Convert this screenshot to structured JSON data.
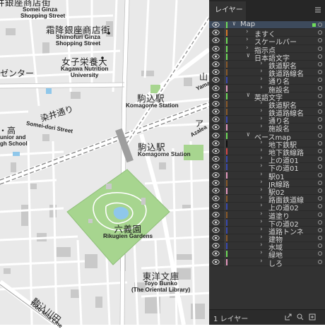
{
  "map": {
    "labels": [
      {
        "key": "somei",
        "jp": "井銀座商店街",
        "en1": "Somei Ginza",
        "en2": "Shopping Street"
      },
      {
        "key": "shimofuri",
        "jp": "霜降銀座商店街",
        "en1": "Shimofuri Ginza",
        "en2": "Shopping Street"
      },
      {
        "key": "kagawa",
        "jp": "女子栄養大",
        "en1": "Kagawa Nutrition",
        "en2": "University"
      },
      {
        "key": "komagome_st1",
        "jp": "駒込駅",
        "en1": "Komagome Station",
        "en2": ""
      },
      {
        "key": "komagome_st2",
        "jp": "駒込駅",
        "en1": "Komagome Station",
        "en2": ""
      },
      {
        "key": "rikugien",
        "jp": "六義園",
        "en1": "Rikugien Gardens",
        "en2": ""
      },
      {
        "key": "toyo",
        "jp": "東洋文庫",
        "en1": "Toyo Bunko",
        "en2": "(The Oriental Library)"
      }
    ],
    "roads": {
      "someidori_jp": "染井通り",
      "someidori_en": "Somei-dori Street",
      "center_jp": "ゼンター",
      "kou": "・高",
      "junior": "unior and",
      "school": "gh School",
      "yama": "山",
      "yamanote": "Yamat",
      "azalea_jp": "ア",
      "azalea_en": "Azalea",
      "hongo_jp": "駒込川田",
      "hongo_en": "Tobu Mita Line"
    }
  },
  "panel": {
    "tab_label": "レイヤー",
    "menu_icon": "panel-menu-icon",
    "footer_count": "1 レイヤー",
    "layers": [
      {
        "name": "Map",
        "indent": 0,
        "expanded": true,
        "color": "#6fdc5a",
        "selected": true
      },
      {
        "name": "ますく",
        "indent": 1,
        "expanded": false,
        "color": "#d77a2a"
      },
      {
        "name": "スケールバー",
        "indent": 1,
        "expanded": false,
        "color": "#6fdc5a"
      },
      {
        "name": "指示点",
        "indent": 1,
        "expanded": false,
        "color": "#6fdc5a"
      },
      {
        "name": "日本語文字",
        "indent": 1,
        "expanded": true,
        "color": "#6fdc5a"
      },
      {
        "name": "鉄道駅名",
        "indent": 2,
        "expanded": false,
        "color": "#8a5a2a"
      },
      {
        "name": "鉄道路線名",
        "indent": 2,
        "expanded": false,
        "color": "#8a5a2a"
      },
      {
        "name": "通り名",
        "indent": 2,
        "expanded": false,
        "color": "#3a4ab0"
      },
      {
        "name": "施設名",
        "indent": 2,
        "expanded": false,
        "color": "#e59ac0"
      },
      {
        "name": "英語文字",
        "indent": 1,
        "expanded": true,
        "color": "#6fdc5a"
      },
      {
        "name": "鉄道駅名",
        "indent": 2,
        "expanded": false,
        "color": "#8a5a2a"
      },
      {
        "name": "鉄道路線名",
        "indent": 2,
        "expanded": false,
        "color": "#8a5a2a"
      },
      {
        "name": "通り名",
        "indent": 2,
        "expanded": false,
        "color": "#3a4ab0"
      },
      {
        "name": "施設名",
        "indent": 2,
        "expanded": false,
        "color": "#e59ac0"
      },
      {
        "name": "ベースmap",
        "indent": 1,
        "expanded": true,
        "color": "#6fdc5a"
      },
      {
        "name": "地下鉄駅",
        "indent": 2,
        "expanded": false,
        "color": "#111111"
      },
      {
        "name": "地下鉄線路",
        "indent": 2,
        "expanded": false,
        "color": "#d84848"
      },
      {
        "name": "上の道01",
        "indent": 2,
        "expanded": false,
        "color": "#3a4ab0"
      },
      {
        "name": "下の道01",
        "indent": 2,
        "expanded": false,
        "color": "#3a4ab0"
      },
      {
        "name": "駅01",
        "indent": 2,
        "expanded": false,
        "color": "#e59ac0"
      },
      {
        "name": "JR線路",
        "indent": 2,
        "expanded": false,
        "color": "#8a5a2a"
      },
      {
        "name": "駅02",
        "indent": 2,
        "expanded": false,
        "color": "#e59ac0"
      },
      {
        "name": "路面鉄道線",
        "indent": 2,
        "expanded": false,
        "color": "#8a5a2a"
      },
      {
        "name": "上の道02",
        "indent": 2,
        "expanded": false,
        "color": "#3a4ab0"
      },
      {
        "name": "道塗り",
        "indent": 2,
        "expanded": false,
        "color": "#8a5a2a"
      },
      {
        "name": "下の道02",
        "indent": 2,
        "expanded": false,
        "color": "#3a4ab0"
      },
      {
        "name": "道路トンネ",
        "indent": 2,
        "expanded": false,
        "color": "#3a4ab0"
      },
      {
        "name": "建物",
        "indent": 2,
        "expanded": false,
        "color": "#8a5a2a"
      },
      {
        "name": "水域",
        "indent": 2,
        "expanded": false,
        "color": "#3a4ab0"
      },
      {
        "name": "緑地",
        "indent": 2,
        "expanded": false,
        "color": "#6fdc5a"
      },
      {
        "name": "しろ",
        "indent": 2,
        "expanded": false,
        "color": "#e59ac0"
      }
    ]
  }
}
